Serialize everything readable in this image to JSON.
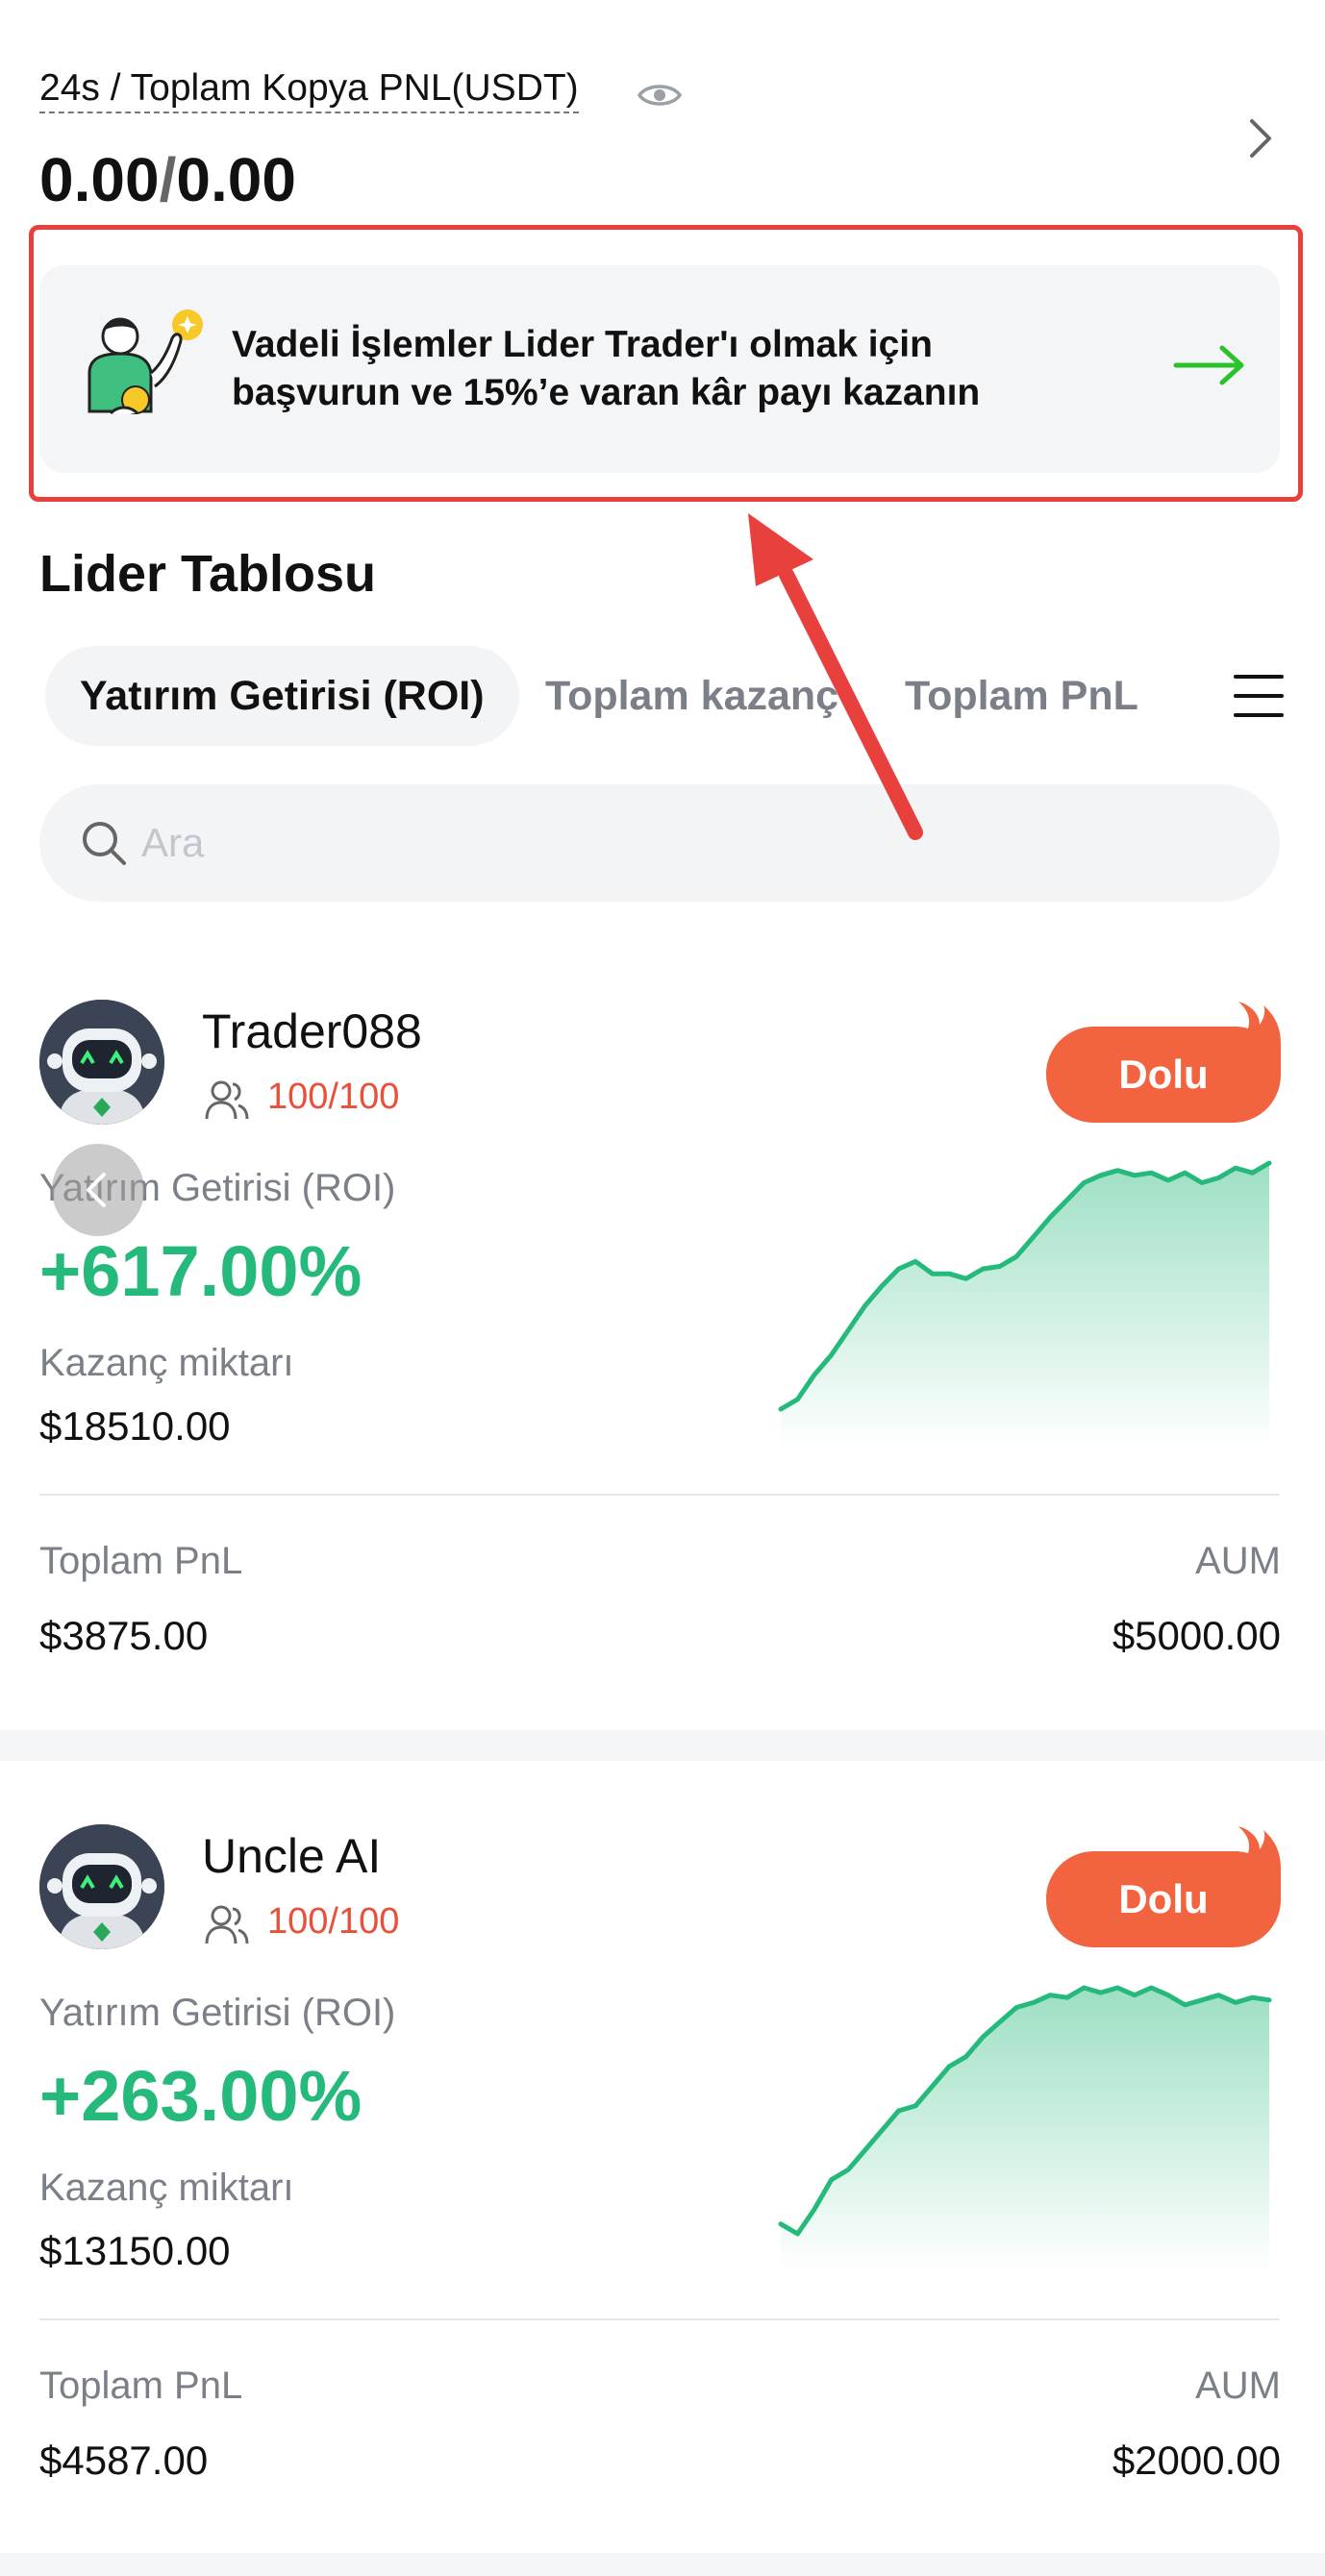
{
  "pnl": {
    "label": "24s / Toplam Kopya PNL(USDT)",
    "value_24h": "0.00",
    "separator": "/",
    "value_total": "0.00"
  },
  "promo": {
    "line1": "Vadeli İşlemler Lider Trader'ı olmak için",
    "line2": "başvurun ve 15%’e varan kâr payı kazanın"
  },
  "leaderboard": {
    "title": "Lider Tablosu",
    "tabs": [
      {
        "label": "Yatırım Getirisi (ROI)",
        "active": true
      },
      {
        "label": "Toplam kazanç",
        "active": false
      },
      {
        "label": "Toplam PnL",
        "active": false
      }
    ],
    "search": {
      "placeholder": "Ara"
    }
  },
  "traders": [
    {
      "name": "Trader088",
      "copiers": "100/100",
      "status": "Dolu",
      "roi_label": "Yatırım Getirisi (ROI)",
      "roi": "+617.00%",
      "earn_label": "Kazanç miktarı",
      "earn": "$18510.00",
      "pnl_label": "Toplam PnL",
      "pnl": "$3875.00",
      "aum_label": "AUM",
      "aum": "$5000.00",
      "trend": [
        0,
        4,
        14,
        22,
        32,
        42,
        50,
        57,
        60,
        55,
        55,
        53,
        57,
        58,
        62,
        70,
        78,
        85,
        92,
        95,
        97,
        95,
        96,
        93,
        96,
        92,
        94,
        98,
        96,
        100
      ]
    },
    {
      "name": "Uncle AI",
      "copiers": "100/100",
      "status": "Dolu",
      "roi_label": "Yatırım Getirisi (ROI)",
      "roi": "+263.00%",
      "earn_label": "Kazanç miktarı",
      "earn": "$13150.00",
      "pnl_label": "Toplam PnL",
      "pnl": "$4587.00",
      "aum_label": "AUM",
      "aum": "$2000.00",
      "trend": [
        4,
        0,
        10,
        22,
        26,
        34,
        42,
        50,
        52,
        60,
        68,
        72,
        80,
        86,
        92,
        94,
        97,
        96,
        100,
        98,
        100,
        97,
        100,
        97,
        93,
        95,
        97,
        94,
        96,
        95
      ]
    }
  ],
  "colors": {
    "accent_green": "#25b97c",
    "badge_orange": "#f2643f",
    "highlight_red": "#e8403d",
    "count_red": "#e8503a"
  }
}
